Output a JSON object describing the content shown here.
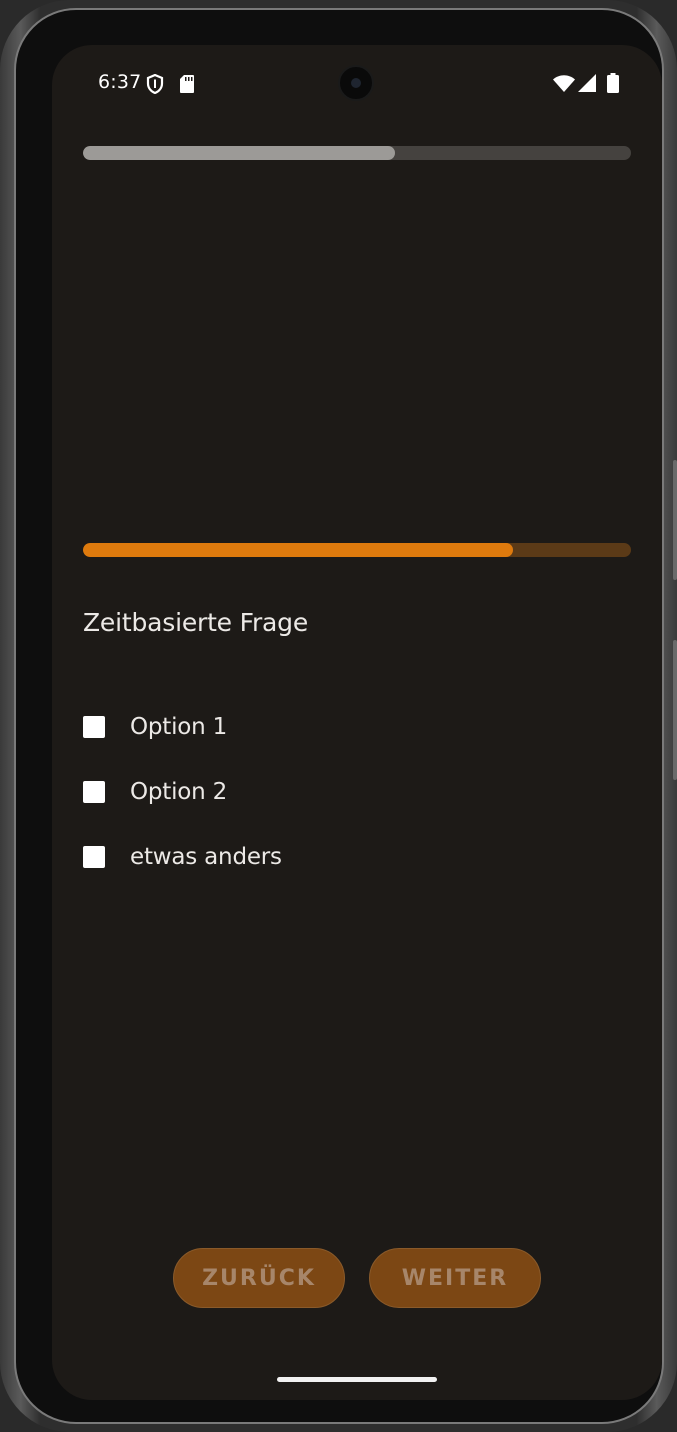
{
  "status_bar": {
    "time": "6:37",
    "left_icons": [
      "shield-icon",
      "sd-card-icon"
    ],
    "right_icons": [
      "wifi-icon",
      "signal-icon",
      "battery-icon"
    ]
  },
  "survey_progress": {
    "fraction": 0.57,
    "track_color": "#45423f",
    "fill_color": "#9c9a97"
  },
  "timer_progress": {
    "fraction": 0.785,
    "track_color": "#5b3a17",
    "fill_color": "#de7a0d"
  },
  "question": {
    "title": "Zeitbasierte Frage",
    "options": [
      {
        "label": "Option 1",
        "checked": false
      },
      {
        "label": "Option 2",
        "checked": false
      },
      {
        "label": "etwas anders",
        "checked": false
      }
    ]
  },
  "navigation": {
    "back_label": "ZURÜCK",
    "next_label": "WEITER"
  },
  "colors": {
    "background": "#1d1a17",
    "accent": "#de7a0d",
    "button_bg": "#7c4714",
    "button_text": "#a7866a",
    "text": "#ece9e6"
  }
}
